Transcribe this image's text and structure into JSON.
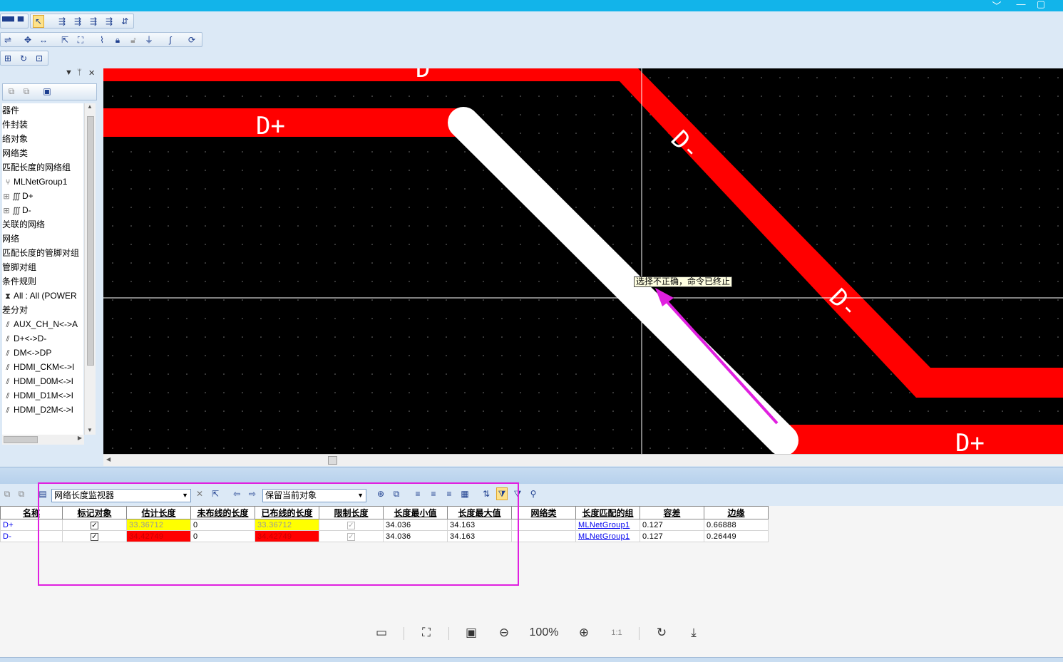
{
  "toolbar": {
    "row1": [
      "layout-icon",
      "select-icon",
      "route-icon-1",
      "route-icon-2",
      "route-icon-3",
      "route-icon-4",
      "route-icon-5"
    ],
    "row2": [
      "move-icon",
      "stretch-icon",
      "select-area-icon",
      "lock-icon",
      "ground-icon",
      "curve-icon",
      "refresh-icon"
    ],
    "row3": [
      "zoom-area-icon",
      "redo-icon",
      "fit-icon"
    ]
  },
  "left_panel": {
    "tree": [
      {
        "icon": "",
        "label": "器件"
      },
      {
        "icon": "",
        "label": "件封装"
      },
      {
        "icon": "",
        "label": "络对象"
      },
      {
        "icon": "",
        "label": "网络类"
      },
      {
        "icon": "",
        "label": "匹配长度的网络组"
      },
      {
        "icon": "group-icon",
        "label": "MLNetGroup1"
      },
      {
        "icon": "net-icon",
        "label": "D+",
        "expand": "⊞"
      },
      {
        "icon": "net-icon",
        "label": "D-",
        "expand": "⊞"
      },
      {
        "icon": "",
        "label": "关联的网络"
      },
      {
        "icon": "",
        "label": "网络"
      },
      {
        "icon": "",
        "label": "匹配长度的管脚对组"
      },
      {
        "icon": "",
        "label": "管脚对组"
      },
      {
        "icon": "",
        "label": "条件规则"
      },
      {
        "icon": "rule-icon",
        "label": "All : All (POWER"
      },
      {
        "icon": "",
        "label": "差分对"
      },
      {
        "icon": "diffpair-icon",
        "label": "AUX_CH_N<->A"
      },
      {
        "icon": "diffpair-icon",
        "label": "D+<->D-"
      },
      {
        "icon": "diffpair-icon",
        "label": "DM<->DP"
      },
      {
        "icon": "diffpair-icon",
        "label": "HDMI_CKM<->I"
      },
      {
        "icon": "diffpair-icon",
        "label": "HDMI_D0M<->I"
      },
      {
        "icon": "diffpair-icon",
        "label": "HDMI_D1M<->I"
      },
      {
        "icon": "diffpair-icon",
        "label": "HDMI_D2M<->I"
      }
    ]
  },
  "canvas": {
    "labels": {
      "dplus_top": "D+",
      "dminus_1": "D-",
      "dminus_2": "D-",
      "dplus_bottom": "D+",
      "top_cut": "D"
    },
    "tooltip": "选择不正确，命令已终止",
    "colors": {
      "trace": "#ff0000",
      "selected": "#ffffff",
      "background": "#000000",
      "arrow": "#e020e0"
    }
  },
  "bottom_panel": {
    "view_select": "网络长度监视器",
    "keep_select": "保留当前对象",
    "columns": [
      "名称",
      "标记对象",
      "估计长度",
      "未布线的长度",
      "已布线的长度",
      "限制长度",
      "长度最小值",
      "长度最大值",
      "网络类",
      "长度匹配的组",
      "容差",
      "边缘"
    ],
    "rows": [
      {
        "name": "D+",
        "mark": "✓",
        "est": "33.36712",
        "unrouted": "0",
        "routed": "33.36712",
        "limit": "✓",
        "min": "34.036",
        "max": "34.163",
        "netclass": "",
        "group": "MLNetGroup1",
        "tol": "0.127",
        "margin": "0.66888",
        "status": "yellow"
      },
      {
        "name": "D-",
        "mark": "✓",
        "est": "34.42749",
        "unrouted": "0",
        "routed": "34.42749",
        "limit": "✓",
        "min": "34.036",
        "max": "34.163",
        "netclass": "",
        "group": "MLNetGroup1",
        "tol": "0.127",
        "margin": "0.26449",
        "status": "red"
      }
    ]
  },
  "viewer": {
    "zoom": "100%",
    "actual_size": "1:1"
  }
}
